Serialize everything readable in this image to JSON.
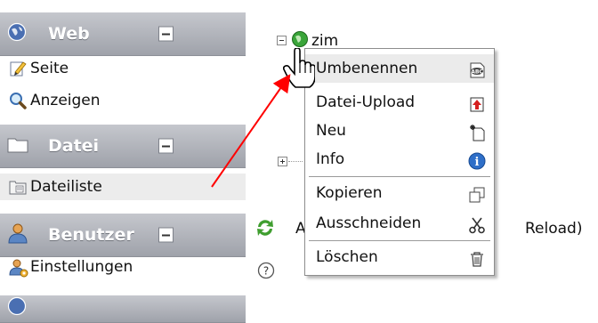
{
  "sidebar": {
    "groups": [
      {
        "label": "Web",
        "icon": "globe-icon",
        "items": [
          {
            "label": "Seite",
            "icon": "page-edit-icon"
          },
          {
            "label": "Anzeigen",
            "icon": "magnifier-icon"
          }
        ]
      },
      {
        "label": "Datei",
        "icon": "folder-icon",
        "items": [
          {
            "label": "Dateiliste",
            "icon": "file-list-icon"
          }
        ]
      },
      {
        "label": "Benutzer",
        "icon": "user-icon",
        "items": [
          {
            "label": "Einstellungen",
            "icon": "user-settings-icon"
          }
        ]
      }
    ]
  },
  "tree": {
    "root_label": "zim",
    "root_icon": "green-globe-icon",
    "partial_left": "A",
    "partial_right": "Reload)",
    "refresh_icon": "refresh-arrows-icon",
    "help_icon": "help-icon"
  },
  "context_menu": {
    "items": [
      {
        "label": "Umbenennen",
        "icon": "rename-abc-icon"
      },
      {
        "label": "Datei-Upload",
        "icon": "upload-icon"
      },
      {
        "label": "Neu",
        "icon": "new-file-icon"
      },
      {
        "label": "Info",
        "icon": "info-icon"
      },
      {
        "label": "Kopieren",
        "icon": "copy-icon"
      },
      {
        "label": "Ausschneiden",
        "icon": "scissors-icon"
      },
      {
        "label": "Löschen",
        "icon": "trash-icon"
      }
    ]
  },
  "colors": {
    "header_top": "#c5c7cd",
    "header_bottom": "#9fa2aa",
    "selected_row": "#ececec",
    "arrow": "#ff0000",
    "menu_border": "#8d8d8d"
  }
}
